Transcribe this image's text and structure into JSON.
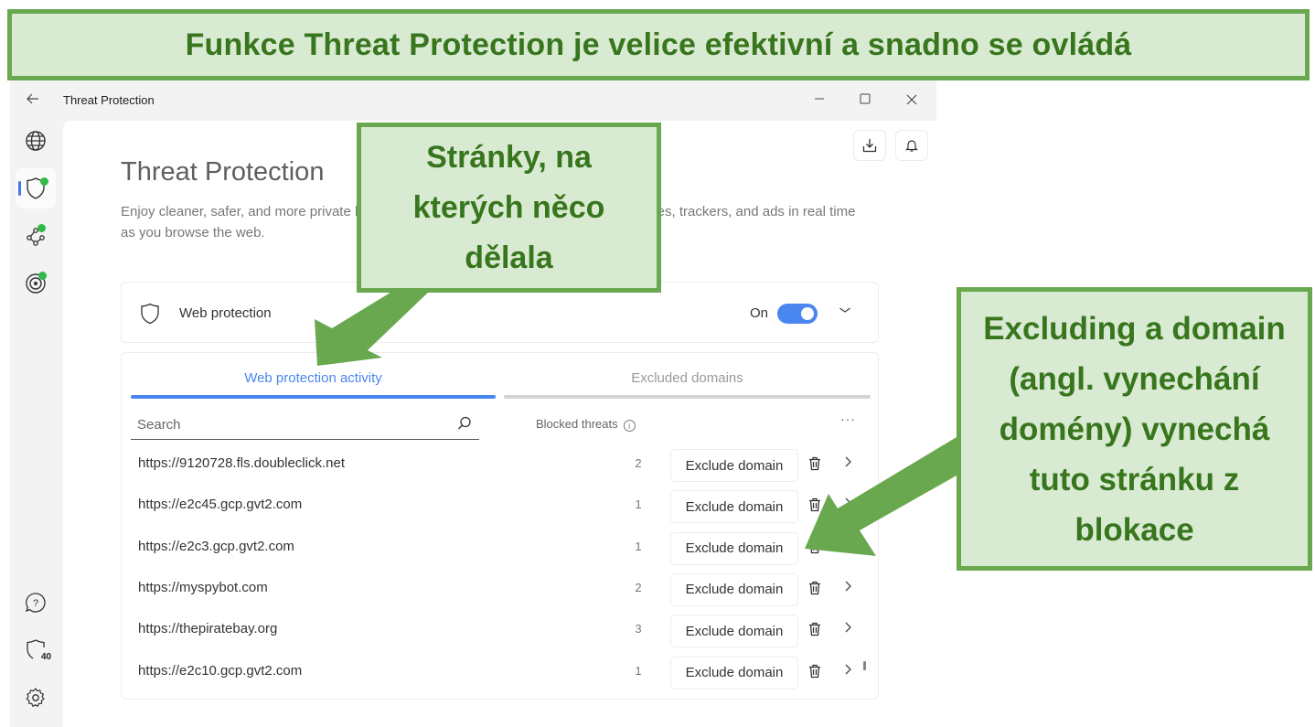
{
  "annotations": {
    "banner": "Funkce Threat Protection je velice efektivní a snadno se ovládá",
    "callout_sites": "Stránky, na kterých něco dělala",
    "callout_exclude": "Excluding a domain (angl. vynechání domény) vynechá tuto stránku z blokace"
  },
  "window": {
    "title": "Threat Protection",
    "back_icon": "arrow-left-icon",
    "controls": [
      "minimize",
      "maximize",
      "close"
    ]
  },
  "sidebar": {
    "items": [
      {
        "name": "globe-icon",
        "active": false,
        "status_dot": false
      },
      {
        "name": "shield-icon",
        "active": true,
        "status_dot": true
      },
      {
        "name": "meshnet-icon",
        "active": false,
        "status_dot": true
      },
      {
        "name": "target-icon",
        "active": false,
        "status_dot": true
      }
    ],
    "bottom_items": [
      {
        "name": "help-icon"
      },
      {
        "name": "shield-count-icon",
        "badge": "40"
      },
      {
        "name": "settings-icon"
      }
    ],
    "status_color": "#2fba4a"
  },
  "header": {
    "title": "Threat Protection",
    "description": "Enjoy cleaner, safer, and more private browsing. Threat Protection blocks harmful websites, trackers, and ads in real time as you browse the web.",
    "description_visible_start": "Enjoy cleaner, safer, and more private",
    "description_visible_end": "s in real time as you browse the",
    "description_line2": "web."
  },
  "web_protection": {
    "label": "Web protection",
    "state_label": "On",
    "enabled": true,
    "accent": "#4a86f0"
  },
  "tabs": [
    {
      "label": "Web protection activity",
      "active": true
    },
    {
      "label": "Excluded domains",
      "active": false
    }
  ],
  "list": {
    "search_placeholder": "Search",
    "column_header": "Blocked threats",
    "more_label": "···",
    "exclude_label": "Exclude domain",
    "rows": [
      {
        "url": "https://9120728.fls.doubleclick.net",
        "blocked": "2"
      },
      {
        "url": "https://e2c45.gcp.gvt2.com",
        "blocked": "1"
      },
      {
        "url": "https://e2c3.gcp.gvt2.com",
        "blocked": "1"
      },
      {
        "url": "https://myspybot.com",
        "blocked": "2"
      },
      {
        "url": "https://thepiratebay.org",
        "blocked": "3"
      },
      {
        "url": "https://e2c10.gcp.gvt2.com",
        "blocked": "1"
      }
    ]
  }
}
